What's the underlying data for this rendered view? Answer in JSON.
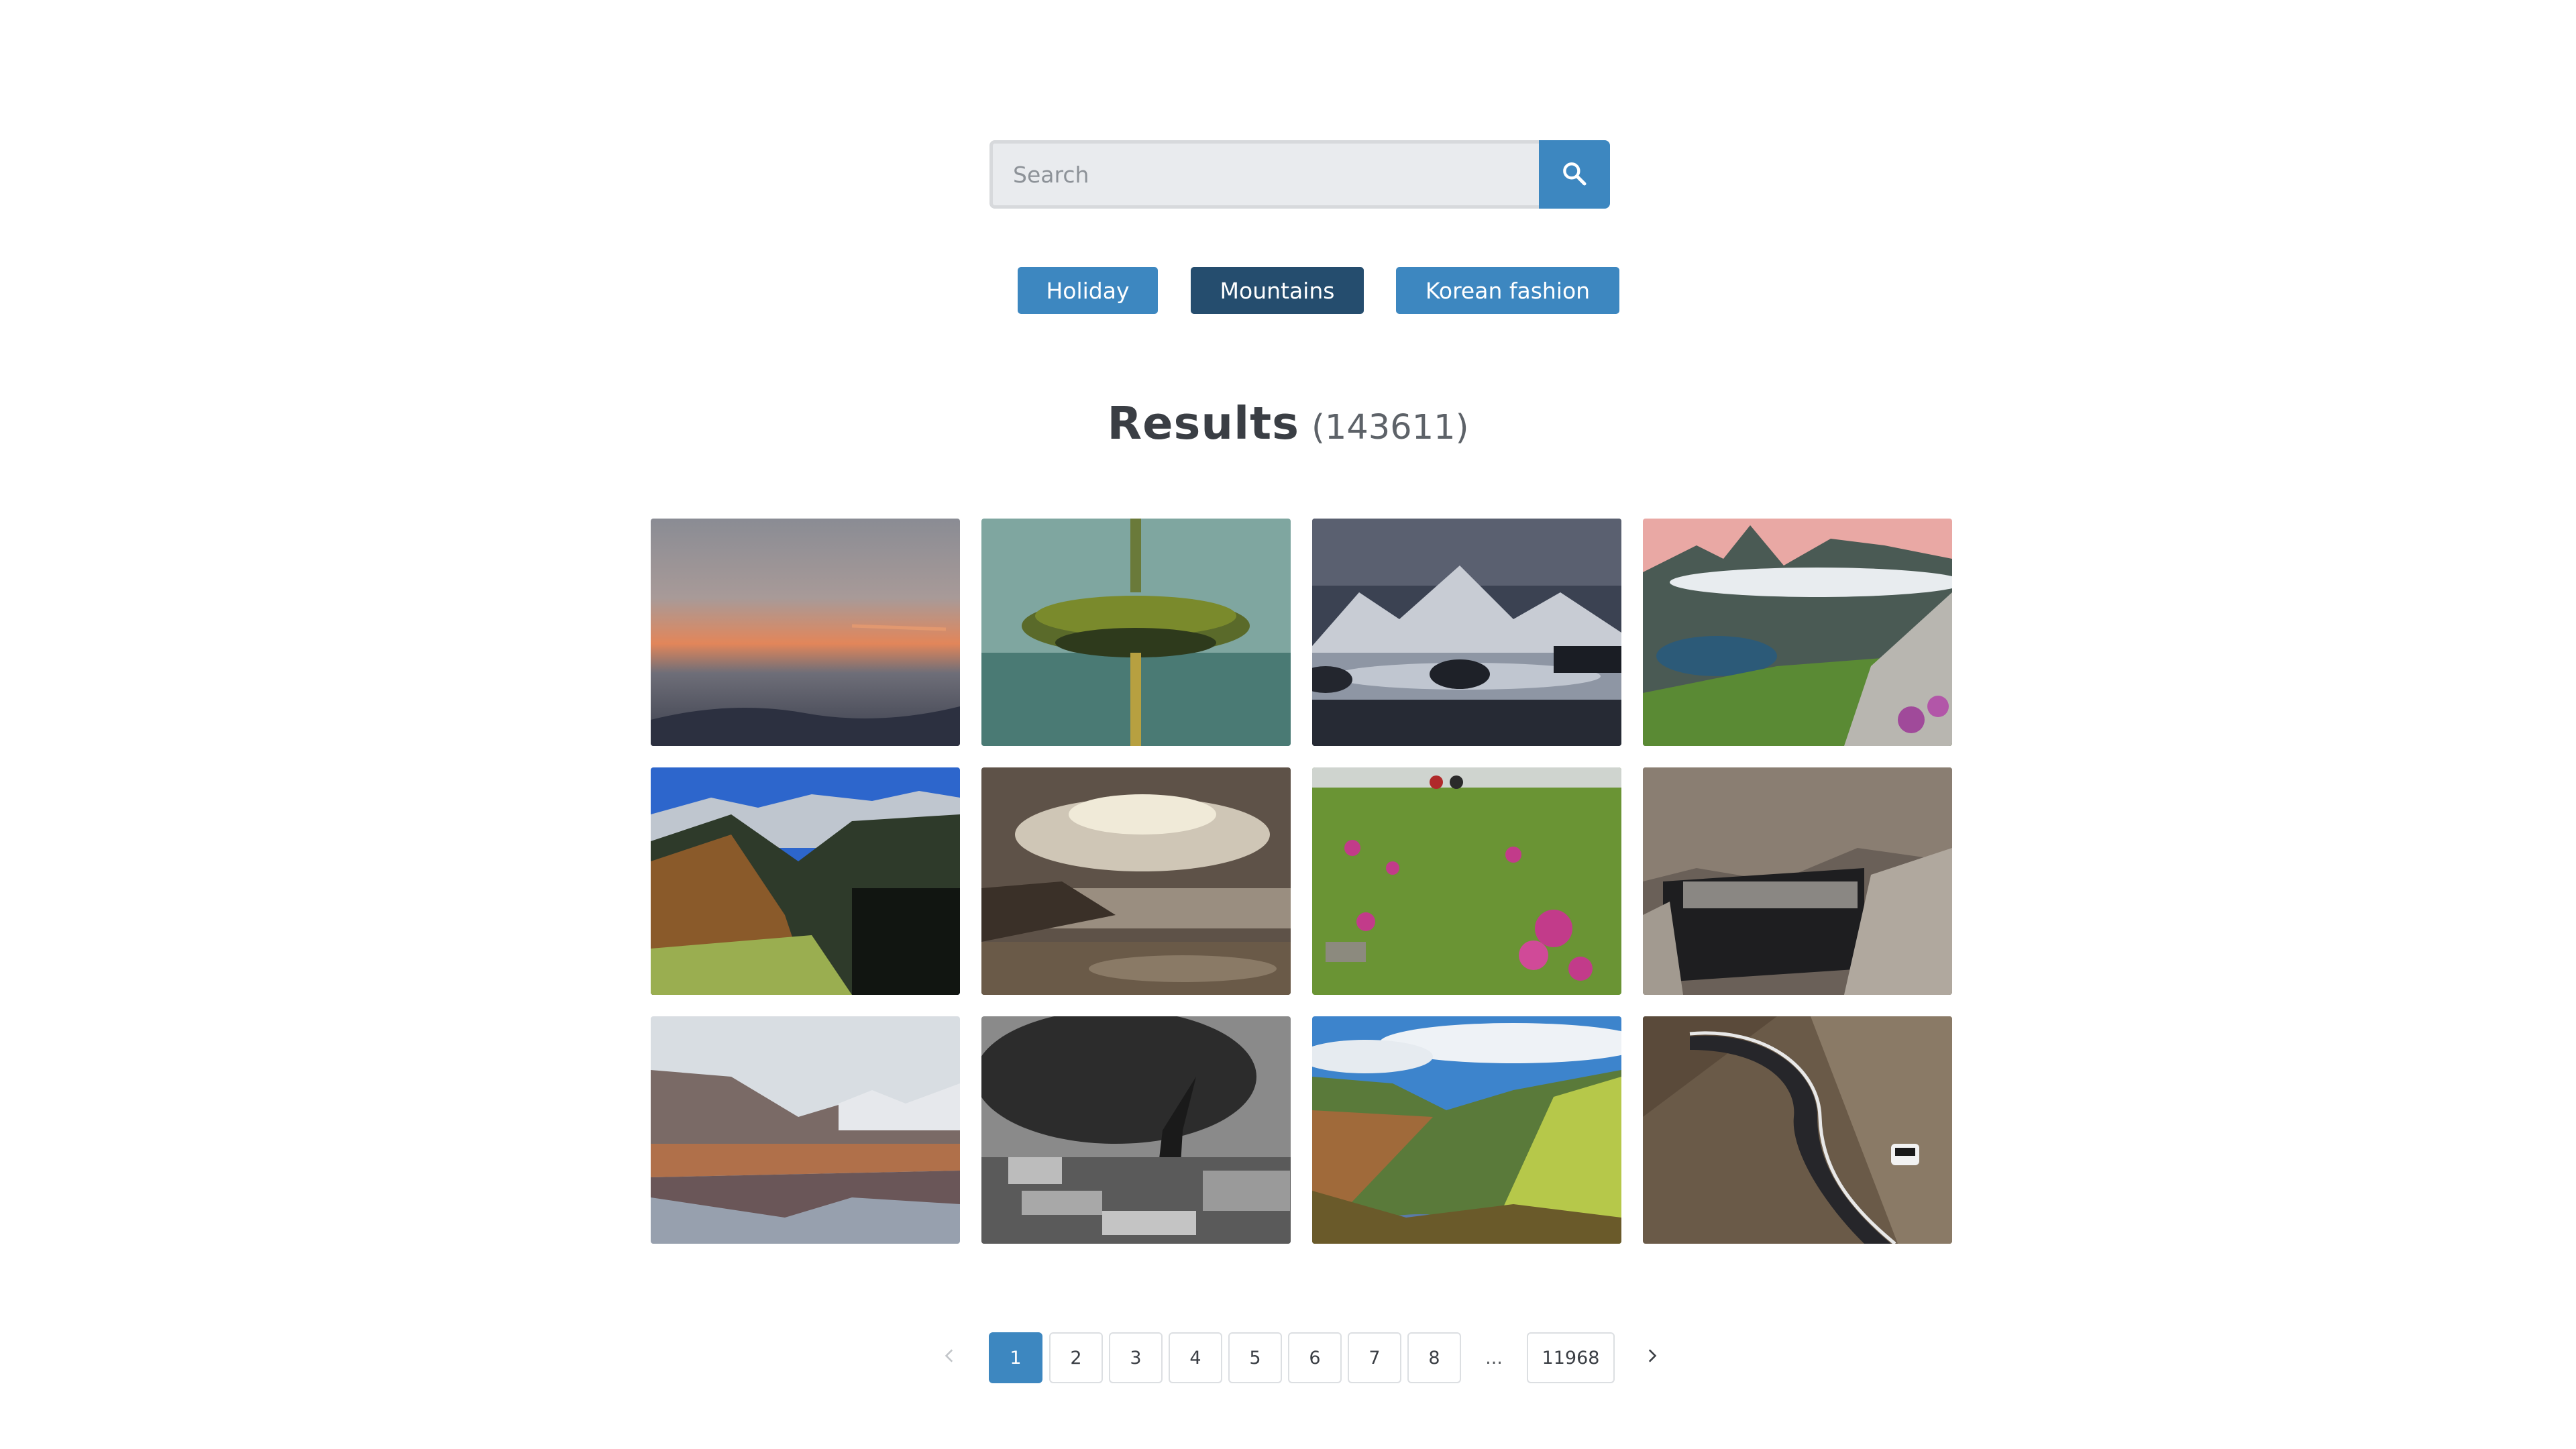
{
  "search": {
    "placeholder": "Search",
    "value": "",
    "button_icon": "search-icon"
  },
  "tags": [
    {
      "label": "Holiday",
      "active": false
    },
    {
      "label": "Mountains",
      "active": true
    },
    {
      "label": "Korean fashion",
      "active": false
    }
  ],
  "results": {
    "title": "Results",
    "count": "(143611)"
  },
  "images": [
    {
      "subject": "orange sunset over hazy mountain ridge"
    },
    {
      "subject": "surreal floating island with tree reflected in water"
    },
    {
      "subject": "snowy peaks over rough sea with rocks"
    },
    {
      "subject": "green mountain valley with clouds and pink heather"
    },
    {
      "subject": "alpine valley with autumn forest under blue sky"
    },
    {
      "subject": "sepia rocky shoreline under dramatic clouds"
    },
    {
      "subject": "green meadow with pink flowers and two hikers"
    },
    {
      "subject": "rocky gorge with dark water"
    },
    {
      "subject": "mountains reflected in calm lake"
    },
    {
      "subject": "black and white old tree among stone ruins"
    },
    {
      "subject": "green valley with stream and cloudy sky"
    },
    {
      "subject": "winding mountain road with white car"
    }
  ],
  "pagination": {
    "prev_icon": "chevron-left-icon",
    "next_icon": "chevron-right-icon",
    "pages": [
      "1",
      "2",
      "3",
      "4",
      "5",
      "6",
      "7",
      "8"
    ],
    "current": "1",
    "ellipsis": "...",
    "last_page": "11968"
  },
  "colors": {
    "accent": "#3d87c0",
    "active_tag": "#254d6e",
    "text": "#3a3e44"
  }
}
